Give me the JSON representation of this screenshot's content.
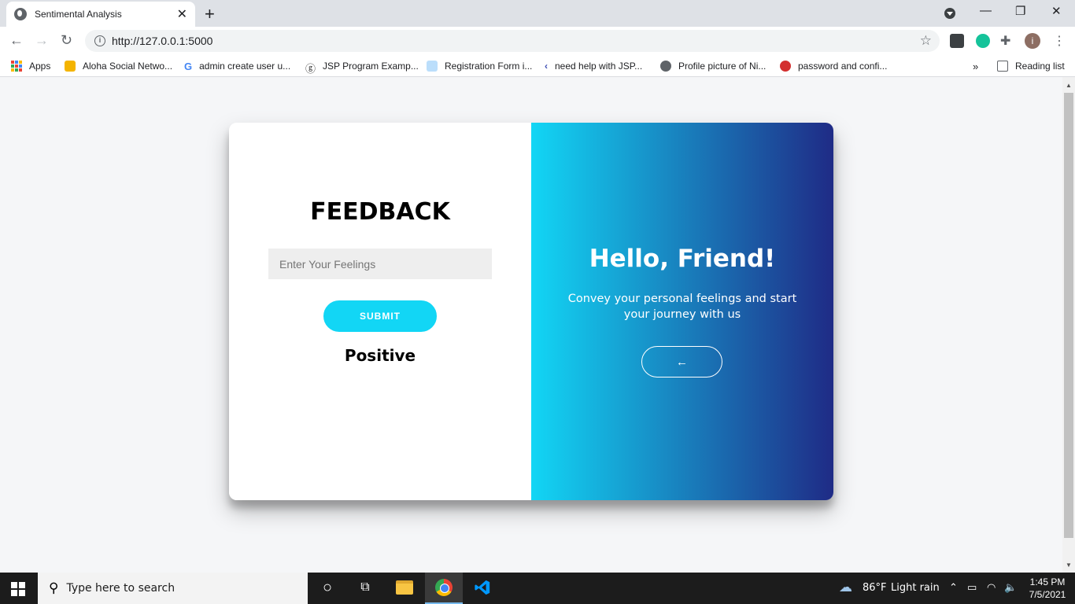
{
  "browser": {
    "tab_title": "Sentimental Analysis",
    "url": "http://127.0.0.1:5000",
    "bookmarks": [
      {
        "label": "Apps"
      },
      {
        "label": "Aloha Social Netwo..."
      },
      {
        "label": "admin create user u..."
      },
      {
        "label": "JSP Program Examp..."
      },
      {
        "label": "Registration Form i..."
      },
      {
        "label": "need help with JSP..."
      },
      {
        "label": "Profile picture of Ni..."
      },
      {
        "label": "password and confi..."
      }
    ],
    "reading_list": "Reading list",
    "overflow": "»",
    "profile_initial": "i"
  },
  "form": {
    "title": "FEEDBACK",
    "input_placeholder": "Enter Your Feelings",
    "submit_label": "SUBMIT",
    "result": "Positive"
  },
  "overlay": {
    "heading": "Hello, Friend!",
    "message": "Convey your personal feelings and start your journey with us",
    "arrow": "🡐"
  },
  "taskbar": {
    "search_placeholder": "Type here to search",
    "weather_temp": "86°F",
    "weather_desc": "Light rain",
    "time": "1:45 PM",
    "date": "7/5/2021"
  },
  "colors": {
    "accent": "#12d6f5",
    "gradient_end": "#1f2b86"
  }
}
